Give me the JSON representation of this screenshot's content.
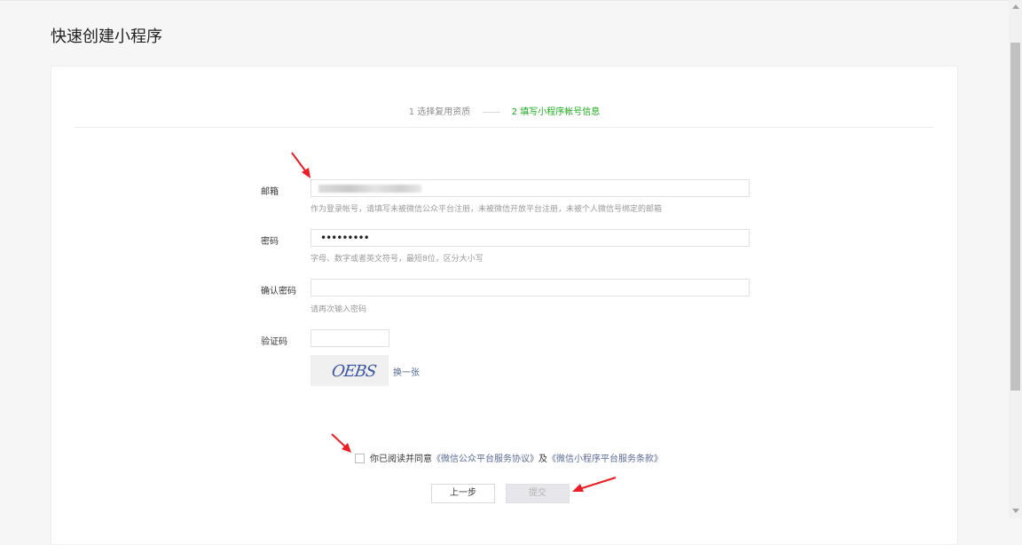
{
  "page": {
    "title": "快速创建小程序"
  },
  "steps": {
    "step1": "1 选择复用资质",
    "step2": "2 填写小程序帐号信息"
  },
  "form": {
    "email": {
      "label": "邮箱",
      "hint": "作为登录帐号，请填写未被微信公众平台注册，未被微信开放平台注册，未被个人微信号绑定的邮箱"
    },
    "password": {
      "label": "密码",
      "masked": "•••••••••",
      "hint": "字母、数字或者英文符号，最短8位，区分大小写"
    },
    "confirm": {
      "label": "确认密码",
      "hint": "请再次输入密码"
    },
    "captcha": {
      "label": "验证码",
      "image_text": "OEBS",
      "refresh": "换一张"
    }
  },
  "agreement": {
    "prefix": "你已阅读并同意",
    "link1": "《微信公众平台服务协议》",
    "conj": "及",
    "link2": "《微信小程序平台服务条款》",
    "checked": false
  },
  "buttons": {
    "prev": "上一步",
    "submit": "提交"
  },
  "colors": {
    "accent": "#1aad19",
    "link": "#576b95",
    "annotation_arrow": "#ee1c25"
  }
}
